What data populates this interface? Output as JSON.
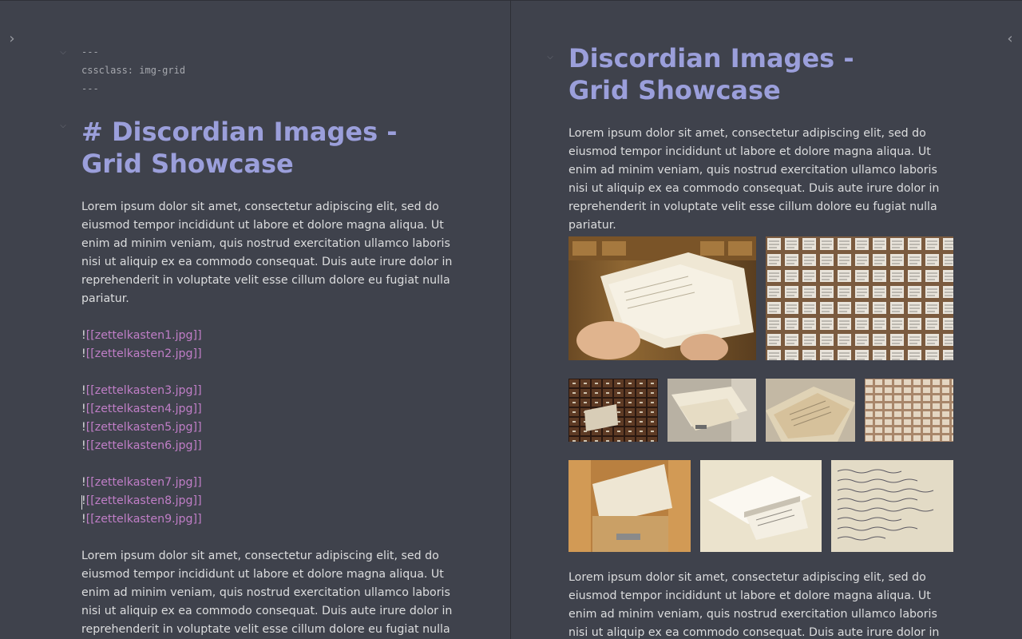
{
  "editor": {
    "frontmatter": {
      "open": "---",
      "cssclass_line": "cssclass: img-grid",
      "close": "---"
    },
    "heading_source": "# Discordian Images - Grid Showcase",
    "paragraph_1": "Lorem ipsum dolor sit amet, consectetur adipiscing elit, sed do eiusmod tempor incididunt ut labore et dolore magna aliqua. Ut enim ad minim veniam, quis nostrud exercitation ullamco laboris nisi ut aliquip ex ea commodo consequat. Duis aute irure dolor in reprehenderit in voluptate velit esse cillum dolore eu fugiat nulla pariatur.",
    "embeds": [
      {
        "bang": "!",
        "link": "[[zettelkasten1.jpg]]"
      },
      {
        "bang": "!",
        "link": "[[zettelkasten2.jpg]]"
      },
      {
        "bang": "!",
        "link": "[[zettelkasten3.jpg]]"
      },
      {
        "bang": "!",
        "link": "[[zettelkasten4.jpg]]"
      },
      {
        "bang": "!",
        "link": "[[zettelkasten5.jpg]]"
      },
      {
        "bang": "!",
        "link": "[[zettelkasten6.jpg]]"
      },
      {
        "bang": "!",
        "link": "[[zettelkasten7.jpg]]"
      },
      {
        "bang": "!",
        "link": "[[zettelkasten8.jpg]]"
      },
      {
        "bang": "!",
        "link": "[[zettelkasten9.jpg]]"
      }
    ],
    "paragraph_2": "Lorem ipsum dolor sit amet, consectetur adipiscing elit, sed do eiusmod tempor incididunt ut labore et dolore magna aliqua. Ut enim ad minim veniam, quis nostrud exercitation ullamco laboris nisi ut aliquip ex ea commodo consequat. Duis aute irure dolor in reprehenderit in voluptate velit esse cillum dolore eu fugiat nulla"
  },
  "preview": {
    "heading": "Discordian Images - Grid Showcase",
    "paragraph_1": "Lorem ipsum dolor sit amet, consectetur adipiscing elit, sed do eiusmod tempor incididunt ut labore et dolore magna aliqua. Ut enim ad minim veniam, quis nostrud exercitation ullamco laboris nisi ut aliquip ex ea commodo consequat. Duis aute irure dolor in reprehenderit in voluptate velit esse cillum dolore eu fugiat nulla pariatur.",
    "paragraph_2": "Lorem ipsum dolor sit amet, consectetur adipiscing elit, sed do eiusmod tempor incididunt ut labore et dolore magna aliqua. Ut enim ad minim veniam, quis nostrud exercitation ullamco laboris nisi ut aliquip ex ea commodo consequat. Duis aute irure dolor in reprehenderit in voluptate"
  },
  "icons": {
    "left_sidebar_toggle": "chevron-right-icon",
    "right_sidebar_toggle": "chevron-left-icon",
    "fold": "chevron-down-icon"
  },
  "colors": {
    "background": "#3f424c",
    "heading": "#9b9fdb",
    "internal_link": "#c07ec7",
    "text": "#dcddde"
  }
}
